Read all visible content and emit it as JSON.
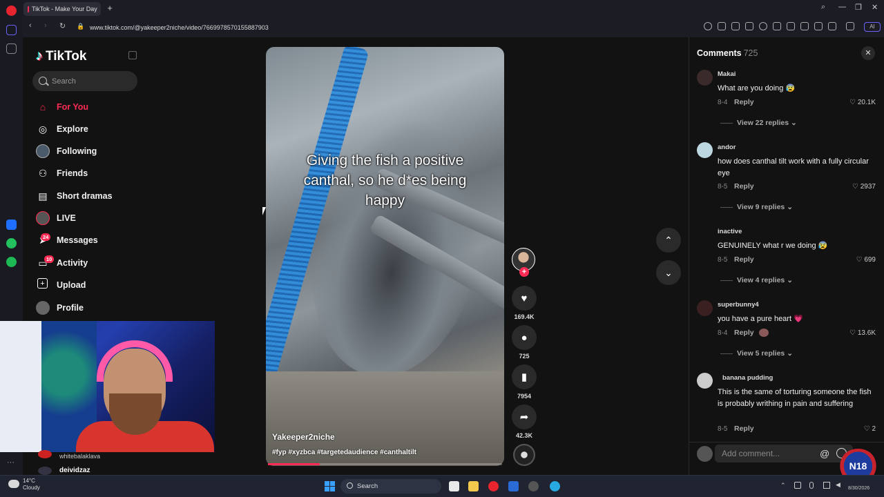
{
  "browser": {
    "tab_title": "TikTok - Make Your Day",
    "url": "www.tiktok.com/@yakeeper2niche/video/7669978570155887903",
    "new_tab": "+"
  },
  "sidebar": {
    "logo": "TikTok",
    "search_placeholder": "Search",
    "items": [
      {
        "label": "For You",
        "icon": "home-icon",
        "active": true
      },
      {
        "label": "Explore",
        "icon": "compass-icon"
      },
      {
        "label": "Following",
        "icon": "following-avatar-icon"
      },
      {
        "label": "Friends",
        "icon": "friends-icon"
      },
      {
        "label": "Short dramas",
        "icon": "film-icon"
      },
      {
        "label": "LIVE",
        "icon": "live-avatar-icon"
      },
      {
        "label": "Messages",
        "icon": "send-icon",
        "badge": "24"
      },
      {
        "label": "Activity",
        "icon": "inbox-icon",
        "badge": "10"
      },
      {
        "label": "Upload",
        "icon": "plus-square-icon"
      },
      {
        "label": "Profile",
        "icon": "profile-avatar-icon"
      }
    ]
  },
  "stream_overlay": {
    "chat_users": [
      "whitebalaklava",
      "deividzaz"
    ]
  },
  "video": {
    "caption": "Giving the fish a positive canthal, so he d*es being happy",
    "author": "Yakeeper2niche",
    "hashtags": "#fyp #xyzbca #targetedaudience #canthaltilt",
    "progress": 0.22
  },
  "actions": {
    "likes": "169.4K",
    "comments": "725",
    "saves": "7954",
    "shares": "42.3K"
  },
  "comments_panel": {
    "title": "Comments",
    "count": "725",
    "input_placeholder": "Add comment...",
    "at_symbol": "@",
    "comments": [
      {
        "user": "Makai",
        "text": "What are you doing 😰",
        "date": "8-4",
        "reply": "Reply",
        "likes": "20.1K",
        "view_replies": "View 22 replies"
      },
      {
        "user": "andor",
        "text": "how does canthal tilt work with a fully circular eye",
        "date": "8-5",
        "reply": "Reply",
        "likes": "2937",
        "view_replies": "View 9 replies"
      },
      {
        "user": "inactive",
        "text": "GENUINELY what r we doing 😰",
        "date": "8-5",
        "reply": "Reply",
        "likes": "699",
        "view_replies": "View 4 replies"
      },
      {
        "user": "superbunny4",
        "text": "you have a pure heart 💗",
        "date": "8-4",
        "reply": "Reply",
        "likes": "13.6K",
        "view_replies": "View 5 replies"
      },
      {
        "user": "banana pudding",
        "text": "This is the same of torturing someone the fish is probably writhing in pain and suffering",
        "date": "8-5",
        "reply": "Reply",
        "likes": "2",
        "view_replies": ""
      }
    ]
  },
  "taskbar": {
    "temperature": "14°C",
    "weather": "Cloudy",
    "search": "Search",
    "date": "8/30/2026"
  },
  "colors": {
    "accent": "#fe2c55",
    "bg": "#121212",
    "panel": "#2a2a2a"
  }
}
